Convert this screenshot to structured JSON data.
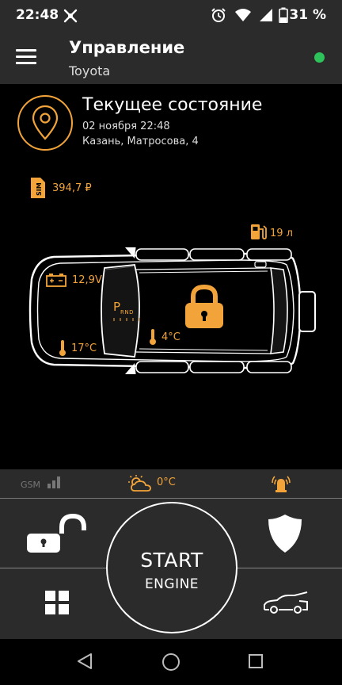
{
  "status_bar": {
    "time": "22:48",
    "battery": "31 %",
    "icons": [
      "vpn-icon",
      "alarm-clock-icon",
      "wifi-icon",
      "signal-icon",
      "battery-icon"
    ]
  },
  "app_bar": {
    "title": "Управление",
    "subtitle": "Toyota",
    "online_color": "#2ec35a"
  },
  "state": {
    "title": "Текущее состояние",
    "date": "02 ноября 22:48",
    "address": "Казань, Матросова, 4"
  },
  "car": {
    "sim_label": "SIM",
    "sim_balance": "394,7 ₽",
    "fuel": "19 л",
    "battery_voltage": "12,9V",
    "cabin_temp": "17°C",
    "engine_temp": "4°C",
    "gear_selected": "P",
    "gear_options": "RND",
    "locked": true
  },
  "info_strip": {
    "gsm_label": "GSM",
    "weather_temp": "0°C"
  },
  "controls": {
    "start_label": "START",
    "engine_label": "ENGINE"
  },
  "colors": {
    "accent": "#f2a43a",
    "panel": "#2b2b2b",
    "background": "#000000"
  }
}
